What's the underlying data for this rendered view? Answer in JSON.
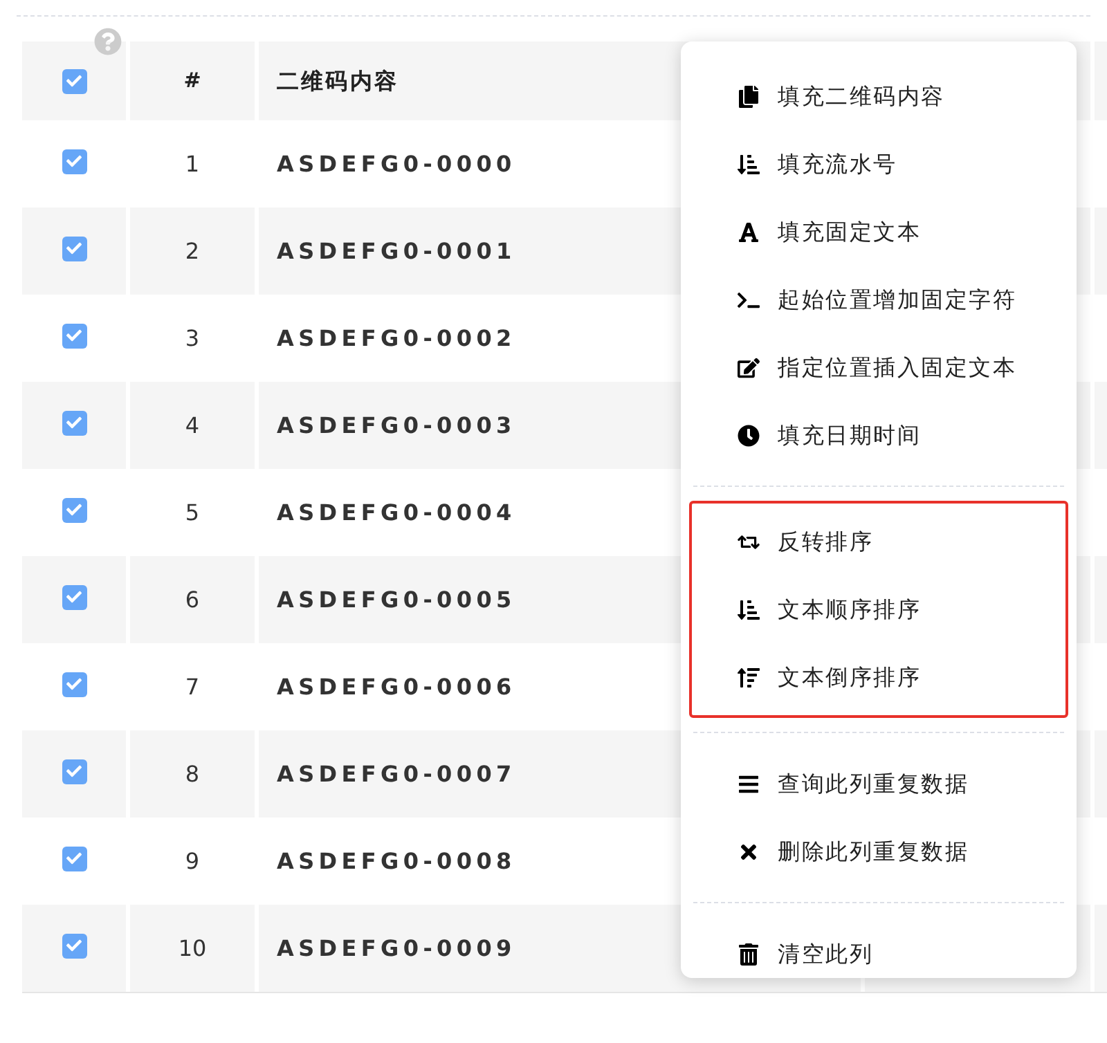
{
  "table": {
    "header": {
      "checked": true,
      "columns": [
        "#",
        "二维码内容"
      ]
    },
    "rows": [
      {
        "checked": true,
        "number": "1",
        "content": "ASDEFG0-0000"
      },
      {
        "checked": true,
        "number": "2",
        "content": "ASDEFG0-0001"
      },
      {
        "checked": true,
        "number": "3",
        "content": "ASDEFG0-0002"
      },
      {
        "checked": true,
        "number": "4",
        "content": "ASDEFG0-0003"
      },
      {
        "checked": true,
        "number": "5",
        "content": "ASDEFG0-0004"
      },
      {
        "checked": true,
        "number": "6",
        "content": "ASDEFG0-0005"
      },
      {
        "checked": true,
        "number": "7",
        "content": "ASDEFG0-0006"
      },
      {
        "checked": true,
        "number": "8",
        "content": "ASDEFG0-0007"
      },
      {
        "checked": true,
        "number": "9",
        "content": "ASDEFG0-0008"
      },
      {
        "checked": true,
        "number": "10",
        "content": "ASDEFG0-0009"
      }
    ]
  },
  "context_menu": {
    "sections": [
      {
        "highlighted": false,
        "items": [
          "填充二维码内容",
          "填充流水号",
          "填充固定文本",
          "起始位置增加固定字符",
          "指定位置插入固定文本",
          "填充日期时间"
        ]
      },
      {
        "highlighted": true,
        "items": [
          "反转排序",
          "文本顺序排序",
          "文本倒序排序"
        ]
      },
      {
        "highlighted": false,
        "items": [
          "查询此列重复数据",
          "删除此列重复数据"
        ]
      },
      {
        "highlighted": false,
        "items": [
          "清空此列"
        ]
      }
    ]
  }
}
